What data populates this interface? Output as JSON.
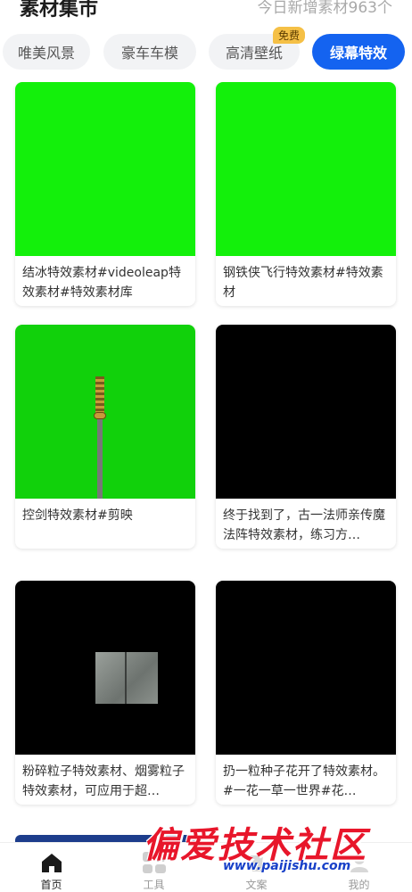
{
  "header": {
    "title": "素材集市",
    "stat_text": "今日新增素材963个"
  },
  "tabs": [
    {
      "label": "唯美风景"
    },
    {
      "label": "豪车车模"
    },
    {
      "label": "高清壁纸",
      "badge": "免费"
    },
    {
      "label": "绿幕特效",
      "active": true
    }
  ],
  "cards": [
    {
      "caption": "结冰特效素材#videoleap特效素材#特效素材库",
      "thumb": "green-screen"
    },
    {
      "caption": "钢铁侠飞行特效素材#特效素材",
      "thumb": "green-screen"
    },
    {
      "caption": "控剑特效素材#剪映",
      "thumb": "green-screen-sword"
    },
    {
      "caption": "终于找到了，古一法师亲传魔法阵特效素材，练习方…",
      "thumb": "black"
    },
    {
      "caption": "粉碎粒子特效素材、烟雾粒子特效素材，可应用于超…",
      "thumb": "black-slab"
    },
    {
      "caption": "扔一粒种子花开了特效素材。#一花一草一世界#花…",
      "thumb": "black"
    }
  ],
  "tabbar": {
    "items": [
      {
        "label": "首页",
        "icon": "home-icon",
        "active": true
      },
      {
        "label": "工具",
        "icon": "tools-icon"
      },
      {
        "label": "文案",
        "icon": "text-icon"
      },
      {
        "label": "我的",
        "icon": "profile-icon"
      }
    ]
  },
  "watermark": {
    "text": "偏爱技术社区",
    "url": "www.paijishu.com"
  },
  "colors": {
    "accent": "#1463f0",
    "green_screen": "#13f00b",
    "badge": "#f5c046",
    "watermark_red": "#e8162b"
  }
}
